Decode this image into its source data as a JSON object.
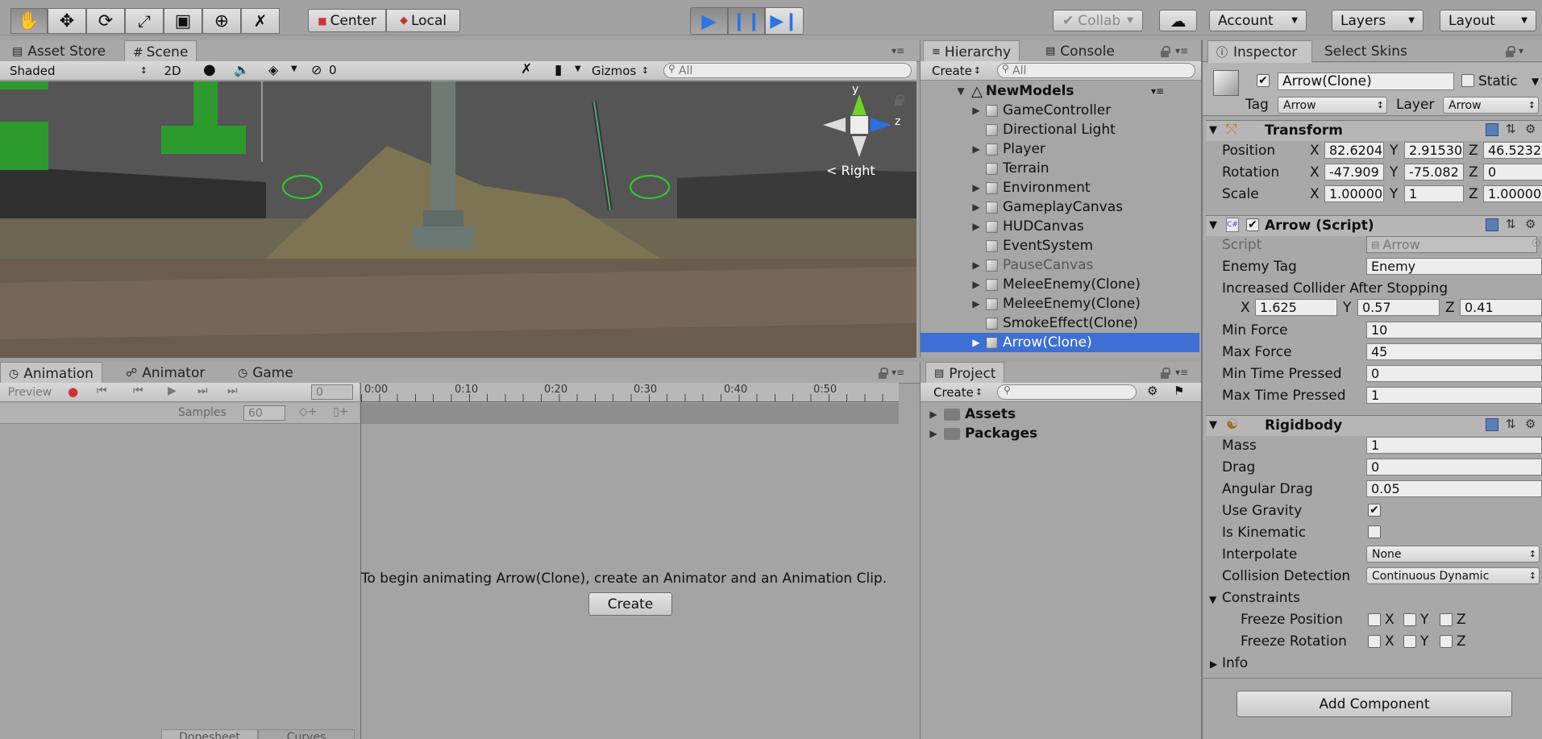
{
  "toolbar": {
    "pivot_center": "Center",
    "pivot_local": "Local",
    "collab": "Collab",
    "account": "Account",
    "layers": "Layers",
    "layout": "Layout"
  },
  "scene_panel": {
    "tab_asset_store": "Asset Store",
    "tab_scene": "Scene",
    "shade_mode": "Shaded",
    "mode_2d": "2D",
    "hidden_count": "0",
    "gizmos": "Gizmos",
    "search_placeholder": "All",
    "gizmo_y": "y",
    "gizmo_z": "z",
    "gizmo_view": "Right"
  },
  "hierarchy": {
    "tab": "Hierarchy",
    "tab_console": "Console",
    "create": "Create",
    "search_placeholder": "All",
    "scene_name": "NewModels",
    "items": [
      {
        "label": "GameController",
        "arrow": "▶"
      },
      {
        "label": "Directional Light",
        "arrow": ""
      },
      {
        "label": "Player",
        "arrow": "▶"
      },
      {
        "label": "Terrain",
        "arrow": ""
      },
      {
        "label": "Environment",
        "arrow": "▶"
      },
      {
        "label": "GameplayCanvas",
        "arrow": "▶"
      },
      {
        "label": "HUDCanvas",
        "arrow": "▶"
      },
      {
        "label": "EventSystem",
        "arrow": ""
      },
      {
        "label": "PauseCanvas",
        "arrow": "▶"
      },
      {
        "label": "MeleeEnemy(Clone)",
        "arrow": "▶"
      },
      {
        "label": "MeleeEnemy(Clone)",
        "arrow": "▶"
      },
      {
        "label": "SmokeEffect(Clone)",
        "arrow": ""
      },
      {
        "label": "Arrow(Clone)",
        "arrow": "▶"
      }
    ]
  },
  "animation_panel": {
    "tab_animation": "Animation",
    "tab_animator": "Animator",
    "tab_game": "Game",
    "preview": "Preview",
    "frame": "0",
    "samples_label": "Samples",
    "samples_value": "60",
    "timeline_ticks": [
      "0:00",
      "0:10",
      "0:20",
      "0:30",
      "0:40",
      "0:50"
    ],
    "message": "To begin animating Arrow(Clone), create an Animator and an Animation Clip.",
    "create_button": "Create",
    "bottom_tab_dopesheet": "Dopesheet",
    "bottom_tab_curves": "Curves"
  },
  "project": {
    "tab": "Project",
    "create": "Create",
    "folders": [
      "Assets",
      "Packages"
    ]
  },
  "inspector": {
    "tab": "Inspector",
    "tab_select_skins": "Select Skins",
    "object_name": "Arrow(Clone)",
    "static": "Static",
    "tag_label": "Tag",
    "tag_value": "Arrow",
    "layer_label": "Layer",
    "layer_value": "Arrow",
    "transform": {
      "title": "Transform",
      "rows": [
        {
          "label": "Position",
          "x": "82.6204",
          "y": "2.91530",
          "z": "46.5232"
        },
        {
          "label": "Rotation",
          "x": "-47.909",
          "y": "-75.082",
          "z": "0"
        },
        {
          "label": "Scale",
          "x": "1.00000",
          "y": "1",
          "z": "1.00000"
        }
      ]
    },
    "script": {
      "title": "Arrow (Script)",
      "script_label": "Script",
      "script_value": "Arrow",
      "enemy_tag_label": "Enemy Tag",
      "enemy_tag_value": "Enemy",
      "collider_label": "Increased Collider After Stopping",
      "collider_x": "1.625",
      "collider_y": "0.57",
      "collider_z": "0.41",
      "fields": [
        {
          "label": "Min Force",
          "value": "10"
        },
        {
          "label": "Max Force",
          "value": "45"
        },
        {
          "label": "Min Time Pressed",
          "value": "0"
        },
        {
          "label": "Max Time Pressed",
          "value": "1"
        }
      ]
    },
    "rigidbody": {
      "title": "Rigidbody",
      "mass_label": "Mass",
      "mass": "1",
      "drag_label": "Drag",
      "drag": "0",
      "angular_drag_label": "Angular Drag",
      "angular_drag": "0.05",
      "use_gravity_label": "Use Gravity",
      "use_gravity": true,
      "is_kinematic_label": "Is Kinematic",
      "is_kinematic": false,
      "interpolate_label": "Interpolate",
      "interpolate": "None",
      "collision_label": "Collision Detection",
      "collision": "Continuous Dynamic",
      "constraints": "Constraints",
      "freeze_position": "Freeze Position",
      "freeze_rotation": "Freeze Rotation",
      "axis_x": "X",
      "axis_y": "Y",
      "axis_z": "Z",
      "info": "Info"
    },
    "add_component": "Add Component"
  },
  "colors": {
    "accent_blue": "#3a72d8",
    "selected_row": "#3e6fd4",
    "green_text": "#2e9a30"
  }
}
